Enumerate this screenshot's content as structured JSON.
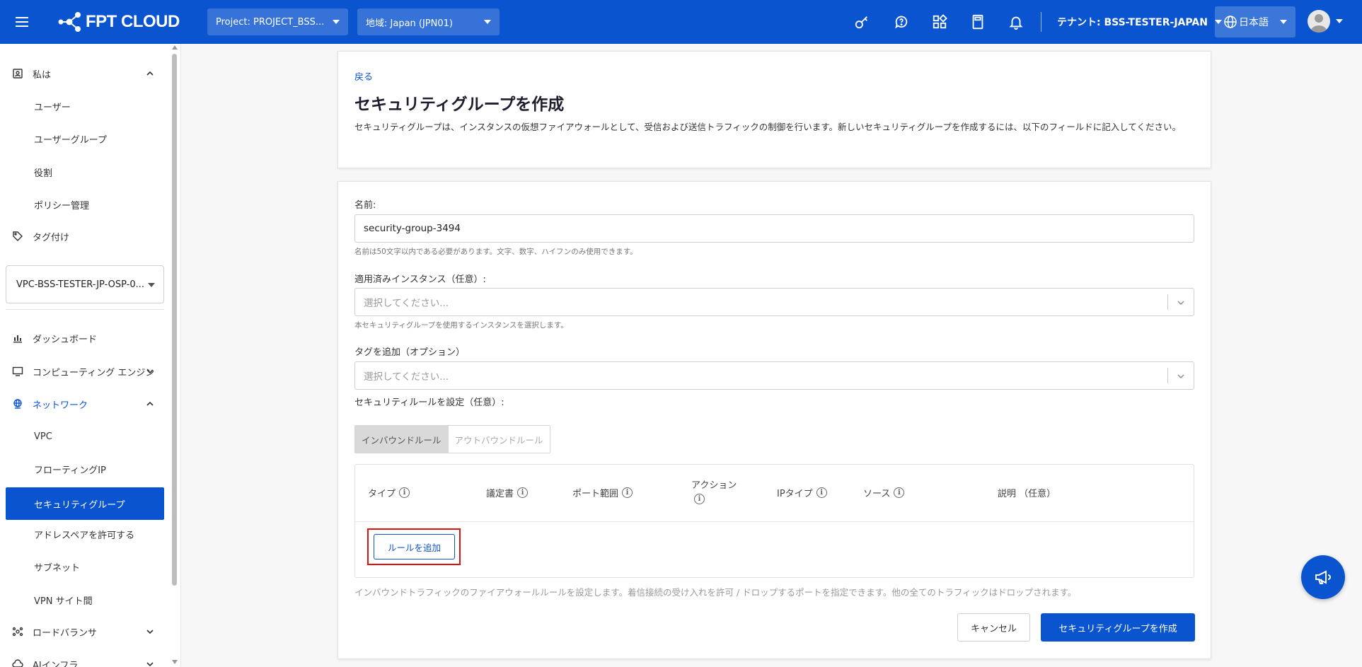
{
  "header": {
    "brand": "FPT CLOUD",
    "project": "Project: PROJECT_BSS...",
    "region": "地域: Japan (JPN01)",
    "tenant": "テナント: BSS-TESTER-JAPAN",
    "language": "日本語",
    "icons": [
      "key-icon",
      "help-icon",
      "apps-icon",
      "calculator-icon",
      "bell-icon"
    ]
  },
  "sidebar": {
    "section_iam": "私は",
    "iam_items": [
      "ユーザー",
      "ユーザーグループ",
      "役割",
      "ポリシー管理"
    ],
    "tagging": "タグ付け",
    "vpc_select": "VPC-BSS-TESTER-JP-OSP-0...",
    "dashboard": "ダッシュボード",
    "compute": "コンピューティング エンジン",
    "network": "ネットワーク",
    "network_items": [
      "VPC",
      "フローティングIP",
      "セキュリティグループ",
      "アドレスペアを許可する",
      "サブネット",
      "VPN サイト間"
    ],
    "load_balancer": "ロードバランサ",
    "ai_infra": "AIインフラ"
  },
  "page": {
    "back": "戻る",
    "title": "セキュリティグループを作成",
    "description": "セキュリティグループは、インスタンスの仮想ファイアウォールとして、受信および送信トラフィックの制御を行います。新しいセキュリティグループを作成するには、以下のフィールドに記入してください。"
  },
  "form": {
    "name_label": "名前:",
    "name_value": "security-group-3494",
    "name_hint": "名前は50文字以内である必要があります。文字、数字、ハイフンのみ使用できます。",
    "instances_label": "適用済みインスタンス（任意）:",
    "instances_placeholder": "選択してください...",
    "instances_hint": "本セキュリティグループを使用するインスタンスを選択します。",
    "tags_label": "タグを追加（オプション）",
    "tags_placeholder": "選択してください...",
    "rules_label": "セキュリティルールを設定（任意）:",
    "tabs": [
      "インバウンドルール",
      "アウトバウンドルール"
    ],
    "active_tab": "インバウンドルール",
    "columns": {
      "type": "タイプ",
      "protocol": "議定書",
      "port_range": "ポート範囲",
      "action": "アクション",
      "ip_type": "IPタイプ",
      "source": "ソース",
      "description": "説明 （任意）"
    },
    "add_rule": "ルールを追加",
    "rules_note": "インバウンドトラフィックのファイアウォールルールを設定します。着信接続の受け入れを許可 / ドロップするポートを指定できます。他の全てのトラフィックはドロップされます。",
    "cancel": "キャンセル",
    "create": "セキュリティグループを作成"
  },
  "colors": {
    "primary": "#0a54d0",
    "highlight": "#e21111"
  }
}
